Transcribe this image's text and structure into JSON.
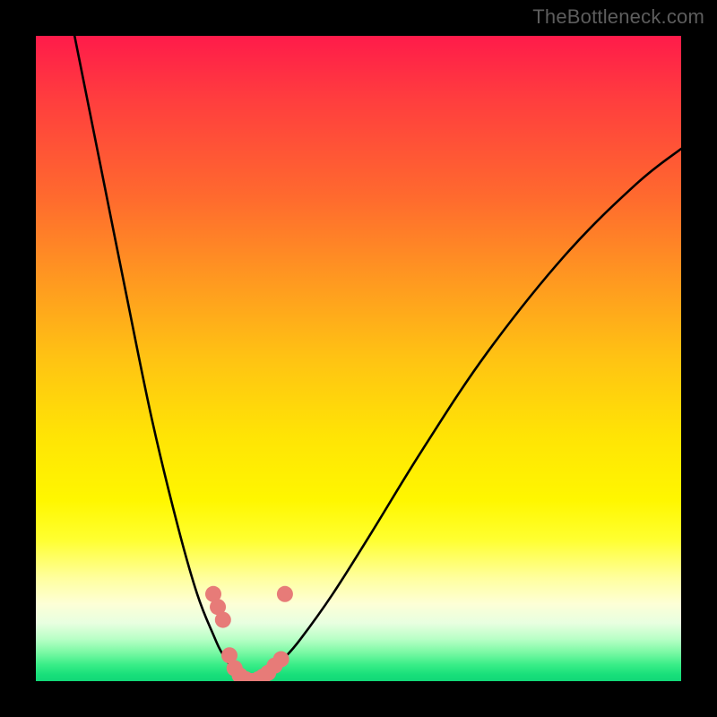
{
  "watermark": {
    "text": "TheBottleneck.com"
  },
  "colors": {
    "frame": "#000000",
    "curve": "#000000",
    "marker": "#e77b78",
    "gradient_top": "#ff1b4a",
    "gradient_bottom": "#12d877"
  },
  "chart_data": {
    "type": "line",
    "title": "",
    "xlabel": "",
    "ylabel": "",
    "xlim": [
      0,
      100
    ],
    "ylim": [
      0,
      100
    ],
    "note": "Chart has no visible axis ticks; x/y in percent of plotting area (x left→right, y bottom→top). Curve and marker coordinates estimated from image.",
    "series": [
      {
        "name": "left-curve",
        "x": [
          6,
          10,
          14,
          18,
          22,
          25,
          27.5,
          29,
          31,
          33.5
        ],
        "y": [
          100,
          80,
          60,
          40.5,
          24,
          13.5,
          7.2,
          4.1,
          1.5,
          0
        ]
      },
      {
        "name": "right-curve",
        "x": [
          33.5,
          36,
          38.5,
          41,
          46,
          52,
          60,
          70,
          82,
          93,
          100
        ],
        "y": [
          0,
          1.3,
          3.6,
          6.5,
          13.5,
          23,
          36,
          51,
          66,
          77,
          82.5
        ]
      }
    ],
    "markers": {
      "name": "highlight-points",
      "x": [
        27.5,
        28.2,
        29.0,
        30.0,
        30.8,
        31.6,
        32.5,
        33.5,
        34.5,
        35.2,
        36.0,
        37.0,
        38.0,
        38.6
      ],
      "y": [
        13.5,
        11.5,
        9.5,
        4.0,
        2.0,
        0.9,
        0.3,
        0.0,
        0.3,
        0.7,
        1.3,
        2.4,
        3.4,
        13.5
      ],
      "color": "#e77b78",
      "size": 9
    }
  }
}
